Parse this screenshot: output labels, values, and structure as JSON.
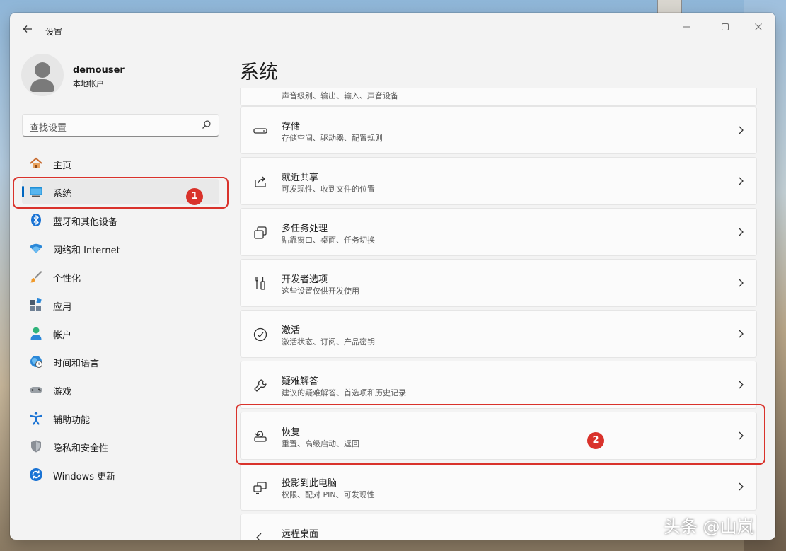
{
  "window": {
    "title": "设置",
    "controls": {
      "minimize": "—",
      "maximize": "☐",
      "close": "✕"
    }
  },
  "profile": {
    "name": "demouser",
    "account_type": "本地帐户"
  },
  "search": {
    "placeholder": "查找设置"
  },
  "nav": {
    "items": [
      {
        "label": "主页",
        "icon": "home-icon"
      },
      {
        "label": "系统",
        "icon": "system-icon",
        "selected": true
      },
      {
        "label": "蓝牙和其他设备",
        "icon": "bluetooth-icon"
      },
      {
        "label": "网络和 Internet",
        "icon": "wifi-icon"
      },
      {
        "label": "个性化",
        "icon": "brush-icon"
      },
      {
        "label": "应用",
        "icon": "apps-icon"
      },
      {
        "label": "帐户",
        "icon": "person-icon"
      },
      {
        "label": "时间和语言",
        "icon": "globe-clock-icon"
      },
      {
        "label": "游戏",
        "icon": "gamepad-icon"
      },
      {
        "label": "辅助功能",
        "icon": "accessibility-icon"
      },
      {
        "label": "隐私和安全性",
        "icon": "shield-icon"
      },
      {
        "label": "Windows 更新",
        "icon": "update-icon"
      }
    ]
  },
  "main": {
    "title": "系统",
    "clipped_row_desc": "声音级别、输出、输入、声音设备",
    "cards": [
      {
        "title": "存储",
        "desc": "存储空间、驱动器、配置规则",
        "icon": "storage-icon"
      },
      {
        "title": "就近共享",
        "desc": "可发现性、收到文件的位置",
        "icon": "share-icon"
      },
      {
        "title": "多任务处理",
        "desc": "贴靠窗口、桌面、任务切换",
        "icon": "multitask-icon"
      },
      {
        "title": "开发者选项",
        "desc": "这些设置仅供开发使用",
        "icon": "developer-icon"
      },
      {
        "title": "激活",
        "desc": "激活状态、订阅、产品密钥",
        "icon": "activation-icon"
      },
      {
        "title": "疑难解答",
        "desc": "建议的疑难解答、首选项和历史记录",
        "icon": "wrench-icon"
      },
      {
        "title": "恢复",
        "desc": "重置、高级启动、返回",
        "icon": "recovery-icon"
      },
      {
        "title": "投影到此电脑",
        "desc": "权限、配对 PIN、可发现性",
        "icon": "projection-icon"
      },
      {
        "title": "远程桌面",
        "desc": "",
        "icon": "remote-desktop-icon"
      }
    ]
  },
  "annotations": {
    "badge_1": "1",
    "badge_2": "2"
  },
  "watermark": "头条 @山岚",
  "colors": {
    "accent": "#0067c0",
    "annotation": "#d9322b"
  }
}
